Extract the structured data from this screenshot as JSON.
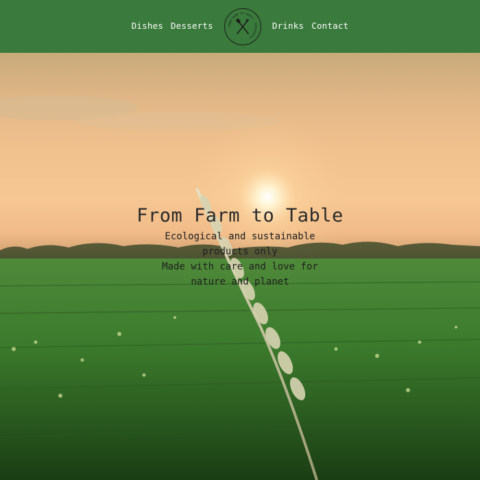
{
  "nav": {
    "left_links": [
      "Dishes",
      "Desserts"
    ],
    "right_links": [
      "Drinks",
      "Contact"
    ],
    "logo_text": "FROM FARM TO TABLE · ECOLOGICAL ·",
    "logo_icon": "fork-spoon-icon"
  },
  "hero": {
    "title": "From Farm to Table",
    "subtitle_line1": "Ecological and sustainable products only",
    "subtitle_line2": "Made with care and love for nature and planet",
    "background": "wheat-field-sunset-photo"
  },
  "colors": {
    "navbar": "#3a7a3c",
    "nav_text": "#ffffff",
    "hero_text": "#1e1e1e"
  }
}
